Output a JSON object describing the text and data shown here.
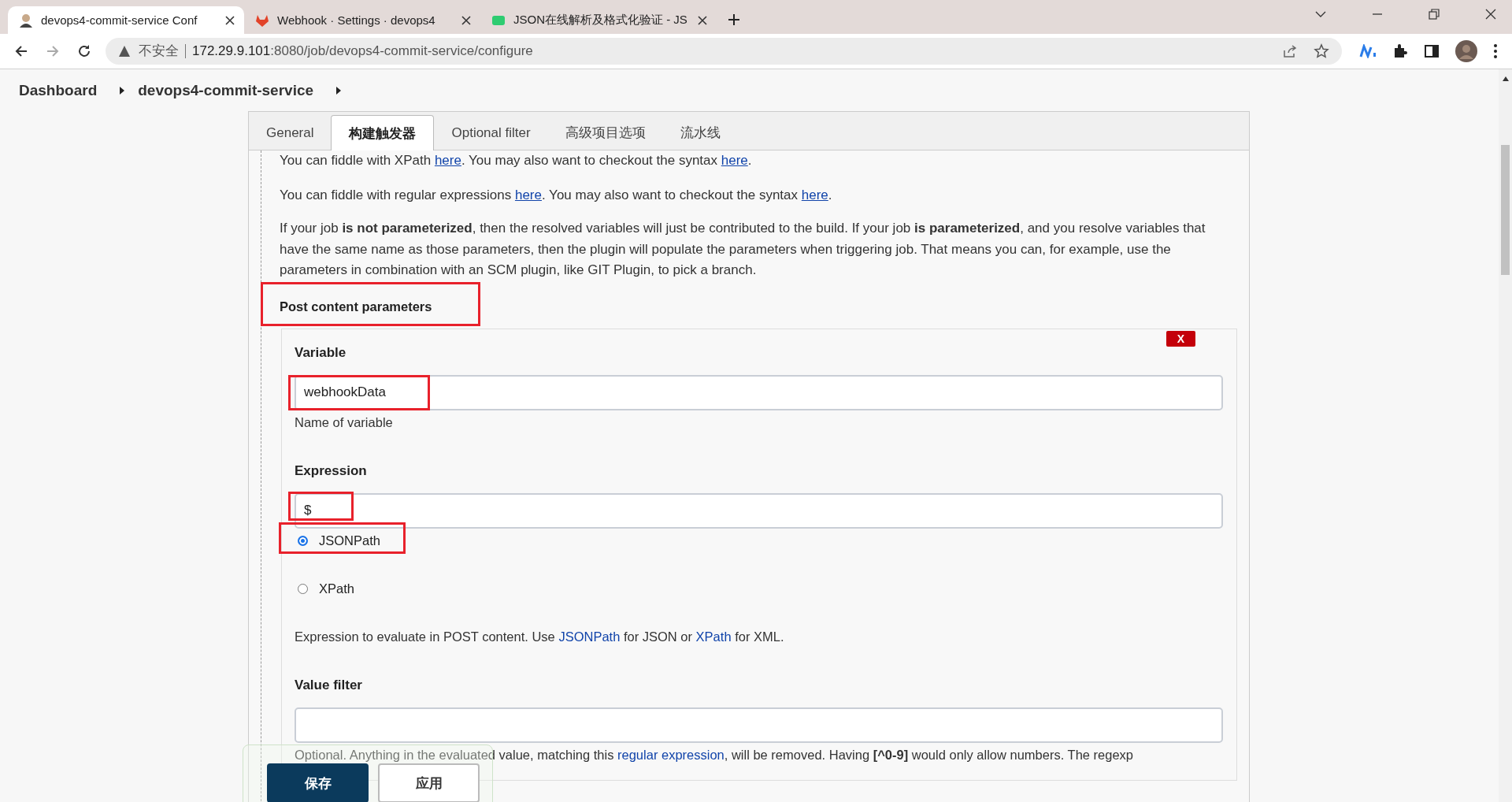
{
  "browser": {
    "tabs": [
      {
        "title": "devops4-commit-service Conf",
        "selected": true
      },
      {
        "title": "Webhook · Settings · devops4",
        "selected": false
      },
      {
        "title": "JSON在线解析及格式化验证 - JS",
        "selected": false
      }
    ],
    "security_label": "不安全",
    "url_host": "172.29.9.101",
    "url_rest": ":8080/job/devops4-commit-service/configure"
  },
  "breadcrumbs": [
    "Dashboard",
    "devops4-commit-service"
  ],
  "config_tabs": [
    {
      "label": "General",
      "selected": false
    },
    {
      "label": "构建触发器",
      "selected": true
    },
    {
      "label": "Optional filter",
      "selected": false
    },
    {
      "label": "高级项目选项",
      "selected": false
    },
    {
      "label": "流水线",
      "selected": false
    }
  ],
  "help_paragraphs": [
    [
      {
        "kind": "text",
        "text": "You can fiddle with XPath "
      },
      {
        "kind": "link",
        "text": "here"
      },
      {
        "kind": "text",
        "text": ". You may also want to checkout the syntax "
      },
      {
        "kind": "link",
        "text": "here"
      },
      {
        "kind": "text",
        "text": "."
      }
    ],
    [
      {
        "kind": "text",
        "text": "You can fiddle with regular expressions "
      },
      {
        "kind": "link",
        "text": "here"
      },
      {
        "kind": "text",
        "text": ". You may also want to checkout the syntax "
      },
      {
        "kind": "link",
        "text": "here"
      },
      {
        "kind": "text",
        "text": "."
      }
    ],
    [
      {
        "kind": "text",
        "text": "If your job "
      },
      {
        "kind": "bold",
        "text": "is not parameterized"
      },
      {
        "kind": "text",
        "text": ", then the resolved variables will just be contributed to the build. If your job "
      },
      {
        "kind": "bold",
        "text": "is parameterized"
      },
      {
        "kind": "text",
        "text": ", and you resolve variables that have the same name as those parameters, then the plugin will populate the parameters when triggering job. That means you can, for example, use the parameters in combination with an SCM plugin, like GIT Plugin, to pick a branch."
      }
    ]
  ],
  "section": {
    "title": "Post content parameters",
    "highlighted": true
  },
  "parameter": {
    "delete_label": "X",
    "variable": {
      "label": "Variable",
      "value": "webhookData",
      "highlighted": true,
      "help": "Name of variable"
    },
    "expression": {
      "label": "Expression",
      "value": "$",
      "highlighted": true,
      "options": [
        {
          "label": "JSONPath",
          "selected": true,
          "highlighted": true
        },
        {
          "label": "XPath",
          "selected": false,
          "highlighted": false
        }
      ],
      "help": [
        {
          "kind": "text",
          "text": "Expression to evaluate in POST content. Use "
        },
        {
          "kind": "link",
          "text": "JSONPath"
        },
        {
          "kind": "text",
          "text": " for JSON or "
        },
        {
          "kind": "link",
          "text": "XPath"
        },
        {
          "kind": "text",
          "text": " for XML."
        }
      ]
    },
    "value_filter": {
      "label": "Value filter",
      "help": [
        {
          "kind": "text",
          "text": "Optional. Anything in the evaluated value, matching this "
        },
        {
          "kind": "link",
          "text": "regular expression"
        },
        {
          "kind": "text",
          "text": ", will be removed. Having "
        },
        {
          "kind": "bold",
          "text": "[^0-9]"
        },
        {
          "kind": "text",
          "text": " would only allow numbers. The regexp"
        }
      ]
    }
  },
  "footer_buttons": [
    {
      "label": "保存",
      "kind": "primary"
    },
    {
      "label": "应用",
      "kind": "secondary"
    }
  ]
}
